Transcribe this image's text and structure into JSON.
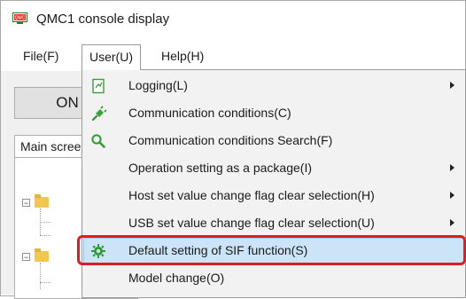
{
  "window": {
    "title": "QMC1 console display",
    "app_icon": "qmc-app-icon"
  },
  "menubar": {
    "items": [
      {
        "label": "File(F)"
      },
      {
        "label": "User(U)",
        "active": true
      },
      {
        "label": "Help(H)"
      }
    ]
  },
  "main": {
    "on_button_label": "ON",
    "tab_label": "Main screen",
    "tree_icon": "folder-icon"
  },
  "dropdown": {
    "items": [
      {
        "label": "Logging(L)",
        "icon": "log-document-icon",
        "submenu": true
      },
      {
        "label": "Communication conditions(C)",
        "icon": "plug-icon",
        "submenu": false
      },
      {
        "label": "Communication conditions Search(F)",
        "icon": "search-icon",
        "submenu": false
      },
      {
        "label": "Operation setting as a package(I)",
        "icon": "",
        "submenu": true
      },
      {
        "label": "Host set value change flag clear selection(H)",
        "icon": "",
        "submenu": true
      },
      {
        "label": "USB set value change flag clear selection(U)",
        "icon": "",
        "submenu": true
      },
      {
        "label": "Default setting of SIF function(S)",
        "icon": "gear-icon",
        "submenu": false,
        "highlighted": true
      },
      {
        "label": "Model change(O)",
        "icon": "",
        "submenu": false
      }
    ]
  },
  "colors": {
    "hover_bg": "#cce4f7",
    "highlight_border": "#e01b22",
    "menu_bg": "#f2f2f2"
  }
}
